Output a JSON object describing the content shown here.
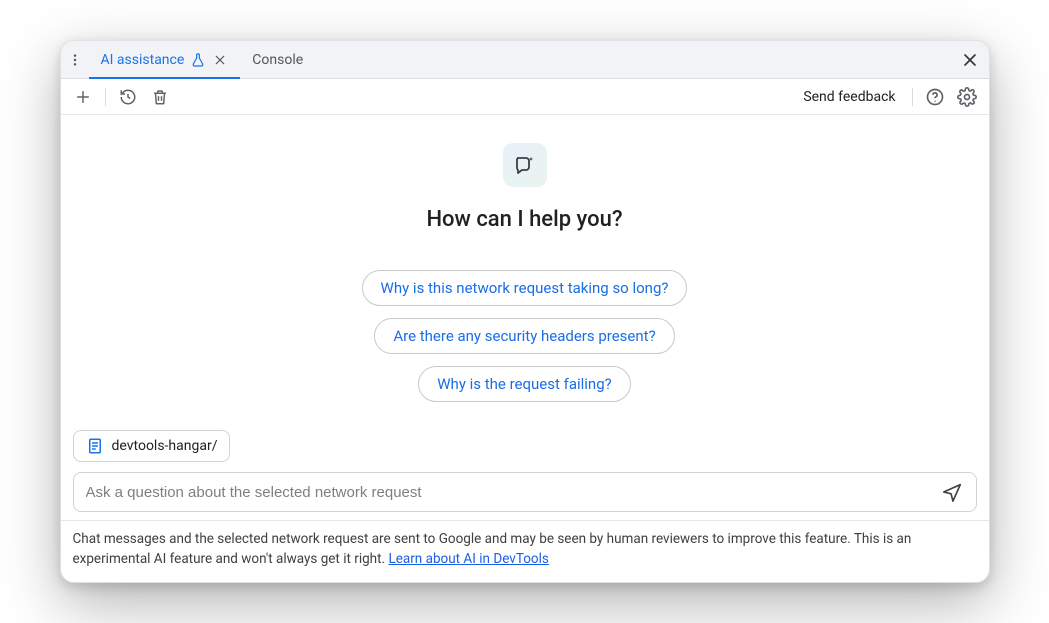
{
  "tabs": {
    "active": {
      "label": "AI assistance"
    },
    "secondary": {
      "label": "Console"
    }
  },
  "toolbar": {
    "send_feedback_label": "Send feedback"
  },
  "hero": {
    "title": "How can I help you?"
  },
  "suggestions": [
    "Why is this network request taking so long?",
    "Are there any security headers present?",
    "Why is the request failing?"
  ],
  "context": {
    "label": "devtools-hangar/"
  },
  "input": {
    "placeholder": "Ask a question about the selected network request"
  },
  "footer": {
    "text": "Chat messages and the selected network request are sent to Google and may be seen by human reviewers to improve this feature. This is an experimental AI feature and won't always get it right. ",
    "link_label": "Learn about AI in DevTools"
  }
}
